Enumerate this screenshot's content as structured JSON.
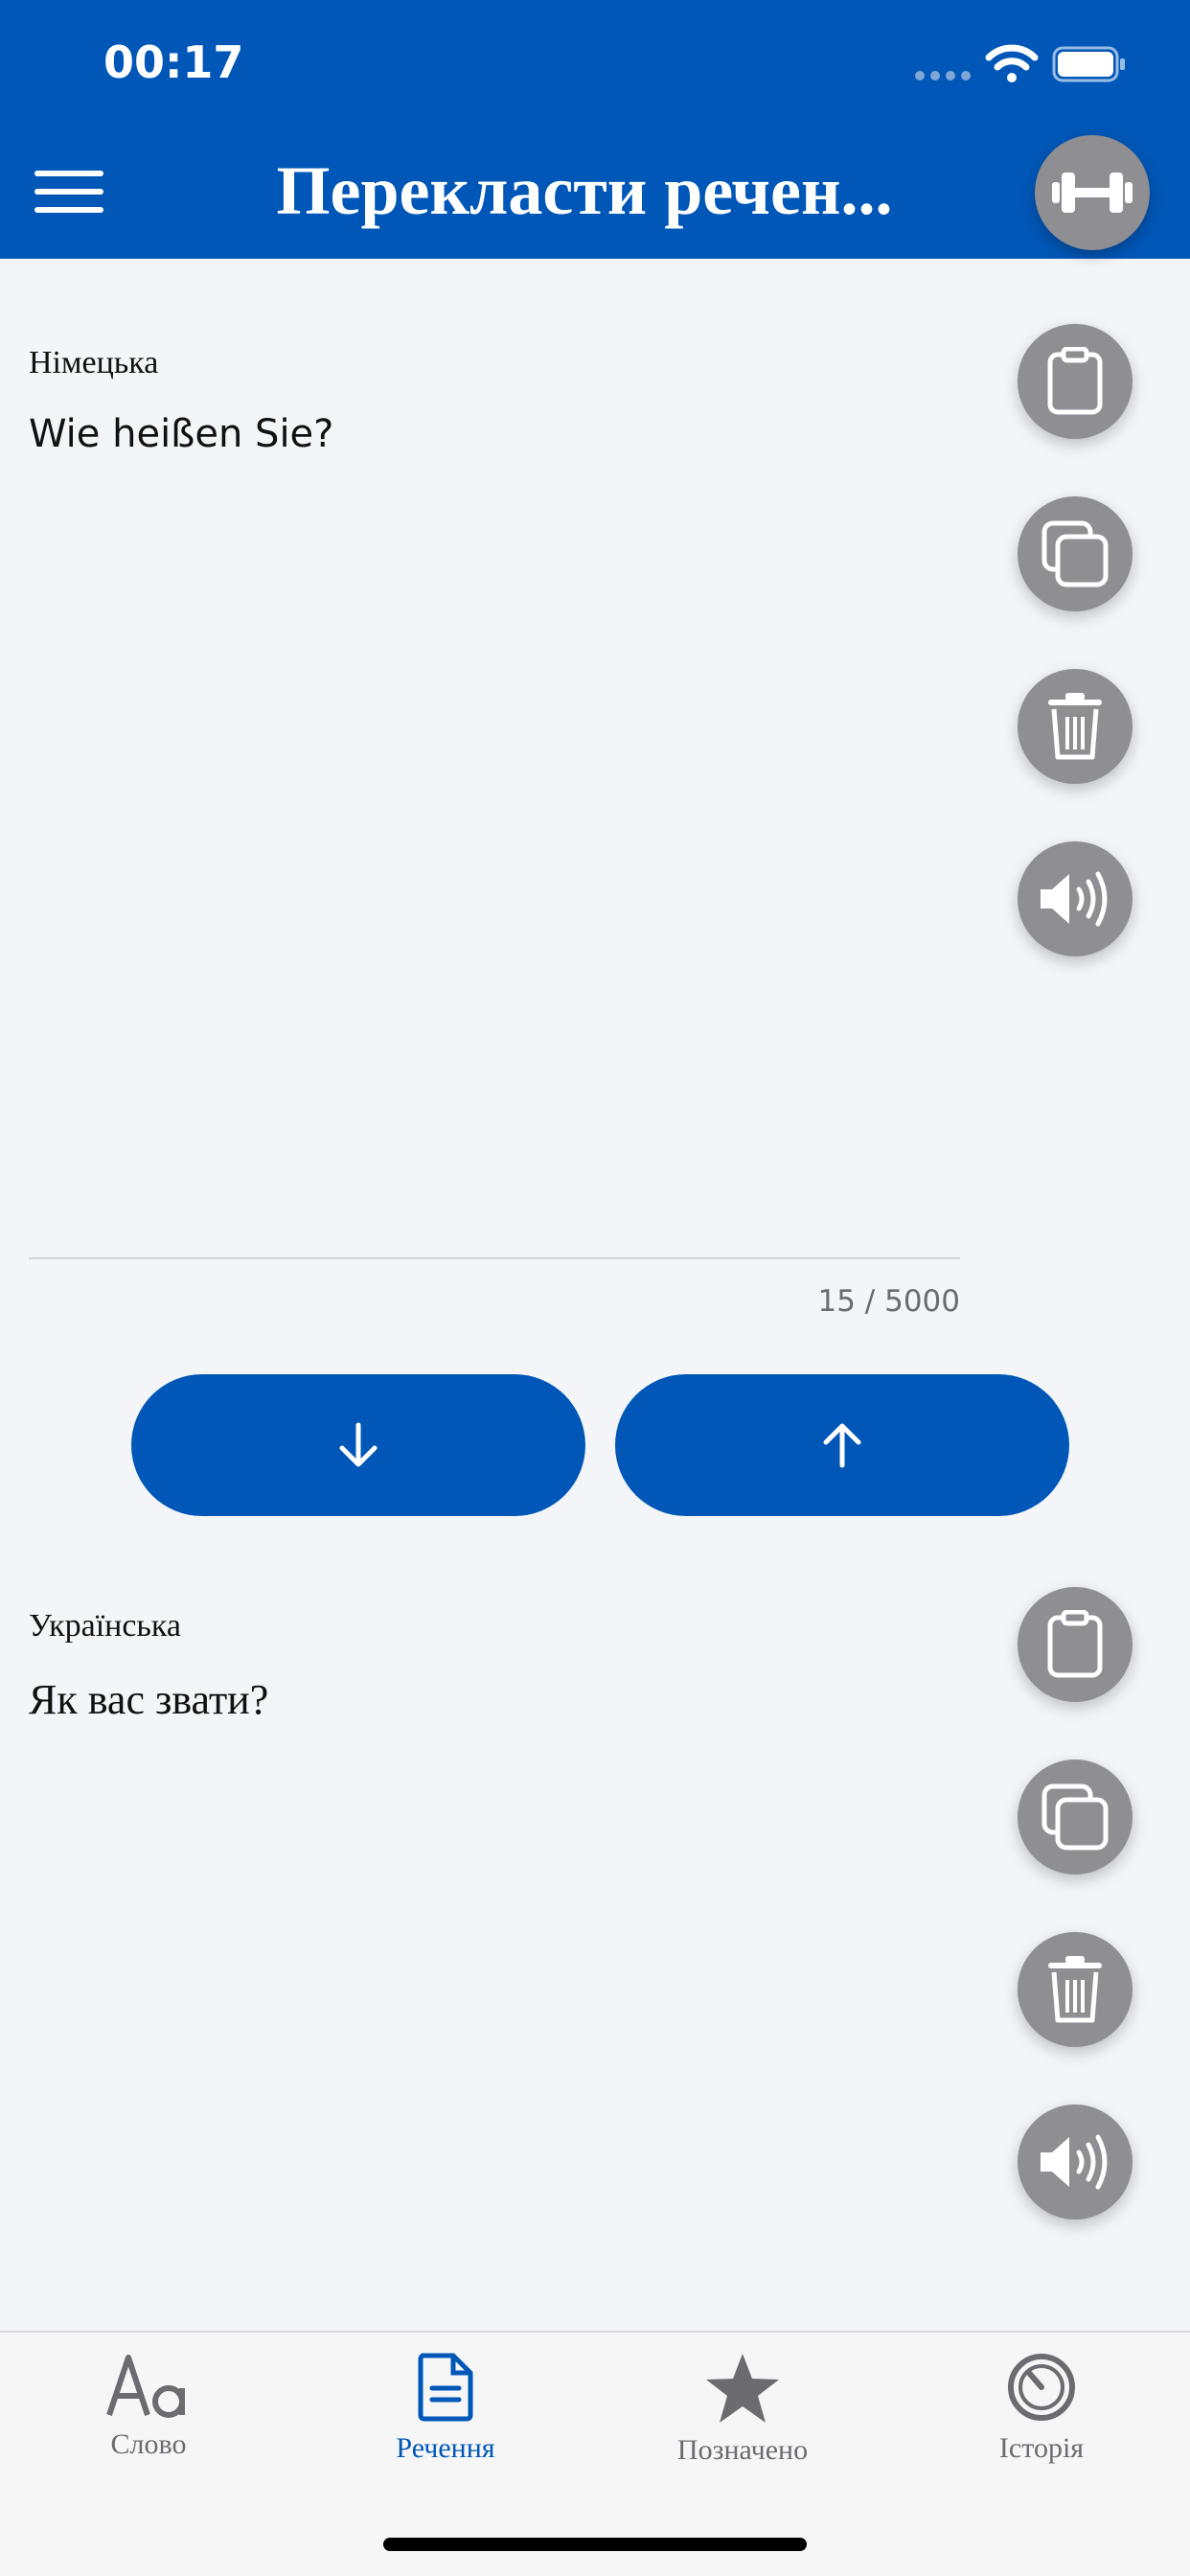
{
  "status_bar": {
    "time": "00:17"
  },
  "header": {
    "title": "Перекласти речен...",
    "menu_icon": "hamburger-menu-icon",
    "action_icon": "dumbbell-icon"
  },
  "source": {
    "language": "Німецька",
    "text": "Wie heißen Sie?",
    "counter": "15 / 5000"
  },
  "target": {
    "language": "Українська",
    "text": "Як вас звати?"
  },
  "actions": {
    "paste_icon": "clipboard-icon",
    "copy_icon": "copy-icon",
    "delete_icon": "trash-icon",
    "speak_icon": "speaker-icon"
  },
  "swap": {
    "down_icon": "arrow-down-icon",
    "up_icon": "arrow-up-icon"
  },
  "tabs": [
    {
      "label": "Слово",
      "icon": "letters-aa-icon",
      "active": false
    },
    {
      "label": "Речення",
      "icon": "document-icon",
      "active": true
    },
    {
      "label": "Позначено",
      "icon": "star-icon",
      "active": false
    },
    {
      "label": "Історія",
      "icon": "history-clock-icon",
      "active": false
    }
  ],
  "colors": {
    "brand": "#0057b7",
    "fab": "#8e8e93",
    "background": "#f3f5f8",
    "inactive": "#6b6b70"
  }
}
